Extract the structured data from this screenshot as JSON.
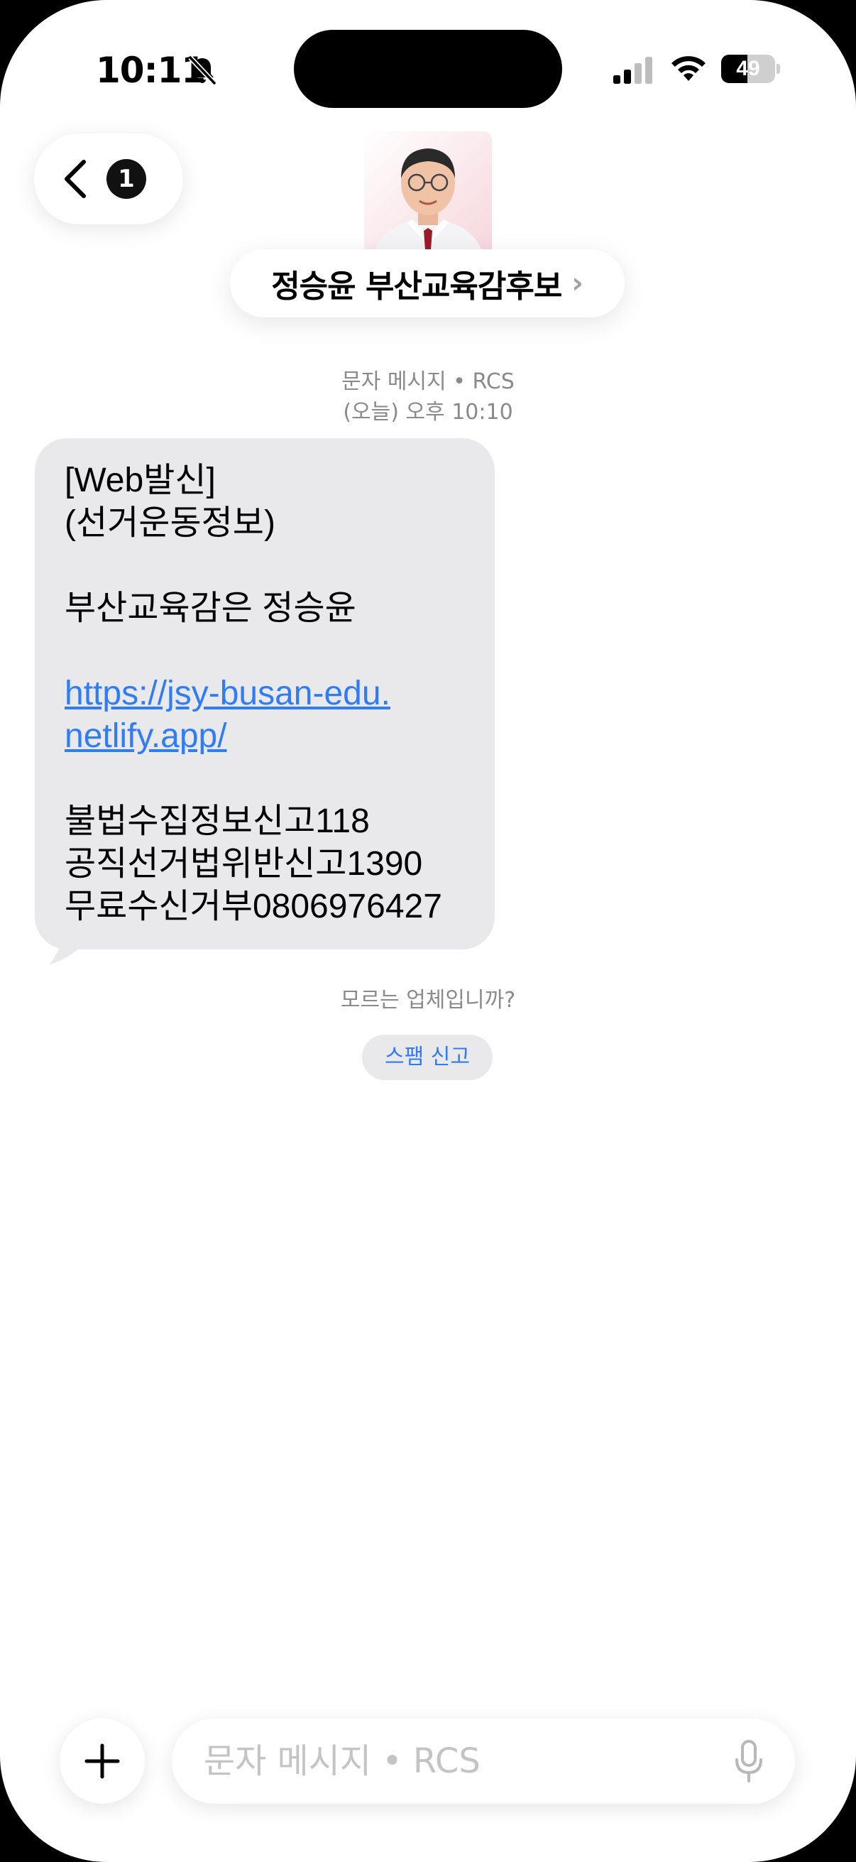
{
  "status_bar": {
    "time": "10:11",
    "battery_level": "49",
    "battery_fraction": 0.49,
    "silent_icon": "bell-slash-icon",
    "signal_icon": "cellular-signal-icon",
    "wifi_icon": "wifi-icon"
  },
  "header": {
    "back_icon": "chevron-left-icon",
    "unread_count": "1",
    "contact_name": "정승윤 부산교육감후보",
    "contact_chevron": "›"
  },
  "conversation": {
    "service_label": "문자 메시지 • RCS",
    "timestamp": "(오늘) 오후 10:10",
    "message": {
      "line1": "[Web발신]",
      "line2": "(선거운동정보)",
      "line3": "부산교육감은 정승윤",
      "link_line1": "https://jsy-busan-edu.",
      "link_line2": "netlify.app/",
      "line4": "불법수집정보신고118",
      "line5": "공직선거법위반신고1390",
      "line6": "무료수신거부0806976427"
    },
    "unknown_sender_question": "모르는 업체입니까?",
    "report_spam_label": "스팸 신고"
  },
  "compose": {
    "add_icon": "plus-icon",
    "placeholder": "문자 메시지 • RCS",
    "mic_icon": "microphone-icon"
  },
  "colors": {
    "link": "#2f7cf6",
    "bubble": "#e9e9eb",
    "meta_text": "#8a8a8e"
  }
}
